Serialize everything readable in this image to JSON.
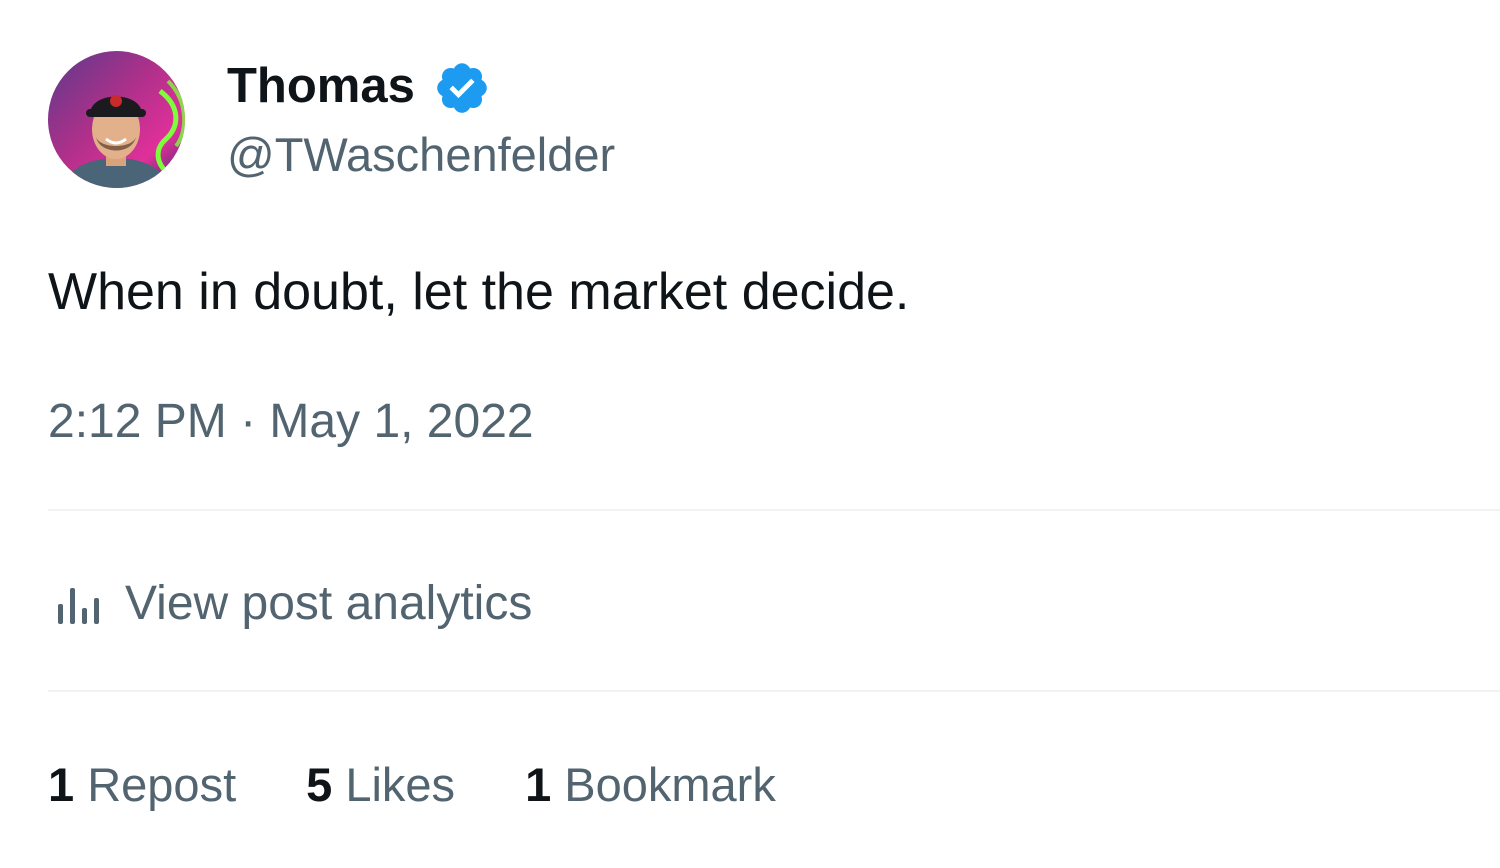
{
  "author": {
    "display_name": "Thomas",
    "handle": "@TWaschenfelder",
    "avatar_icon": "profile-photo",
    "verified_icon": "verified-badge-icon",
    "verified_color": "#1d9bf0"
  },
  "post": {
    "text": "When in doubt, let the market decide.",
    "time": "2:12 PM",
    "separator": " · ",
    "date": "May 1, 2022"
  },
  "analytics": {
    "icon": "analytics-bar-icon",
    "label": "View post analytics"
  },
  "stats": [
    {
      "count": "1",
      "label": "Repost"
    },
    {
      "count": "5",
      "label": "Likes"
    },
    {
      "count": "1",
      "label": "Bookmark"
    }
  ],
  "colors": {
    "text_primary": "#0f1419",
    "text_secondary": "#536471",
    "divider": "#eff3f4"
  }
}
